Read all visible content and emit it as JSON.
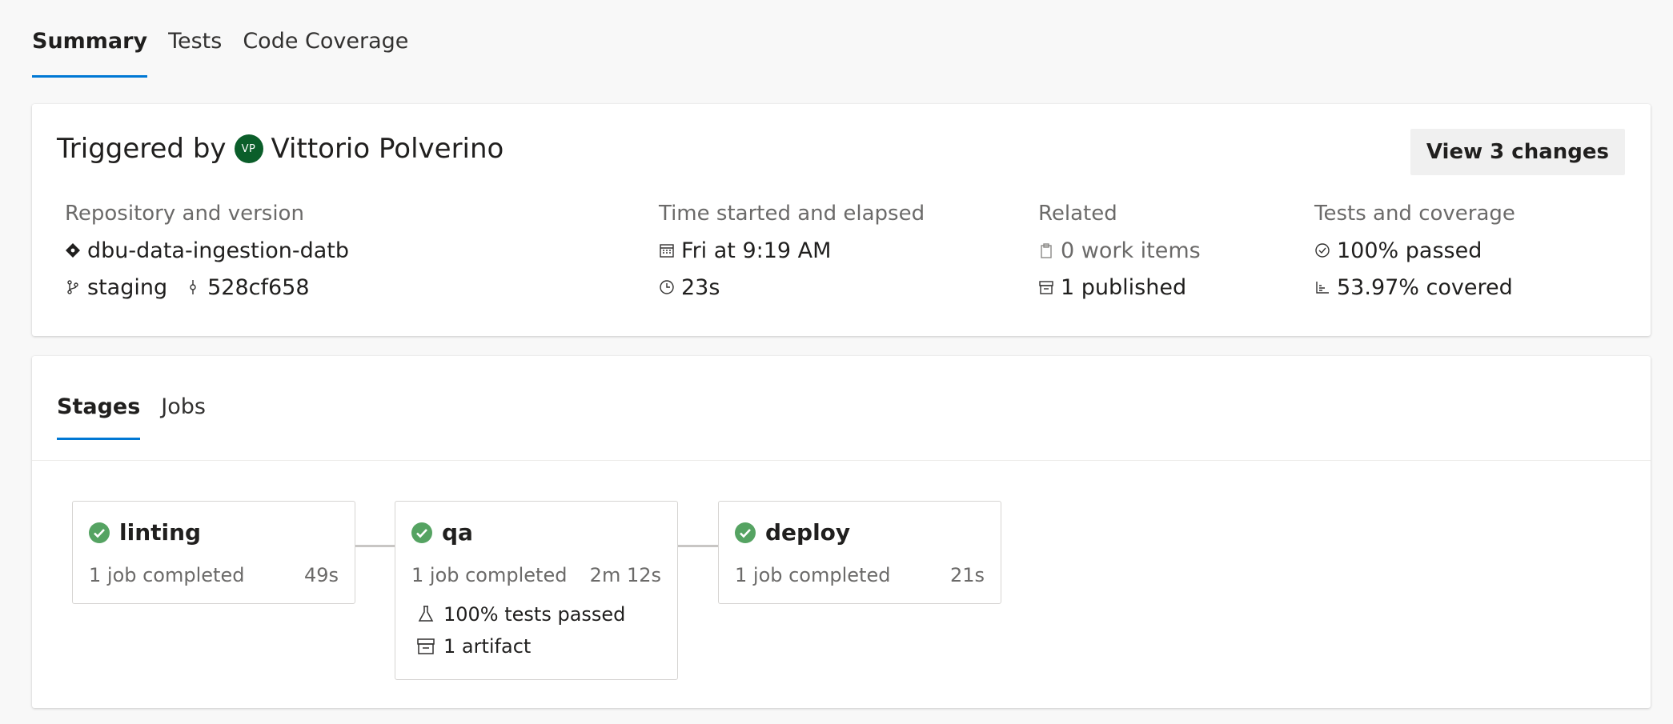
{
  "top_tabs": [
    "Summary",
    "Tests",
    "Code Coverage"
  ],
  "summary": {
    "triggered_by": "Triggered by",
    "avatar_initials": "VP",
    "user_name": "Vittorio Polverino",
    "view_changes_label": "View 3 changes",
    "repo": {
      "header": "Repository and version",
      "name": "dbu-data-ingestion-datb",
      "branch": "staging",
      "commit": "528cf658"
    },
    "time": {
      "header": "Time started and elapsed",
      "started": "Fri at 9:19 AM",
      "elapsed": "23s"
    },
    "related": {
      "header": "Related",
      "work_items": "0 work items",
      "published": "1 published"
    },
    "tests": {
      "header": "Tests and coverage",
      "passed": "100% passed",
      "covered": "53.97% covered"
    }
  },
  "stage_tabs": [
    "Stages",
    "Jobs"
  ],
  "stages": [
    {
      "name": "linting",
      "status": "1 job completed",
      "duration": "49s"
    },
    {
      "name": "qa",
      "status": "1 job completed",
      "duration": "2m 12s",
      "tests": "100% tests passed",
      "artifacts": "1 artifact"
    },
    {
      "name": "deploy",
      "status": "1 job completed",
      "duration": "21s"
    }
  ],
  "colors": {
    "accent": "#0078d4",
    "success": "#55a362",
    "avatar": "#0b5e2a"
  }
}
